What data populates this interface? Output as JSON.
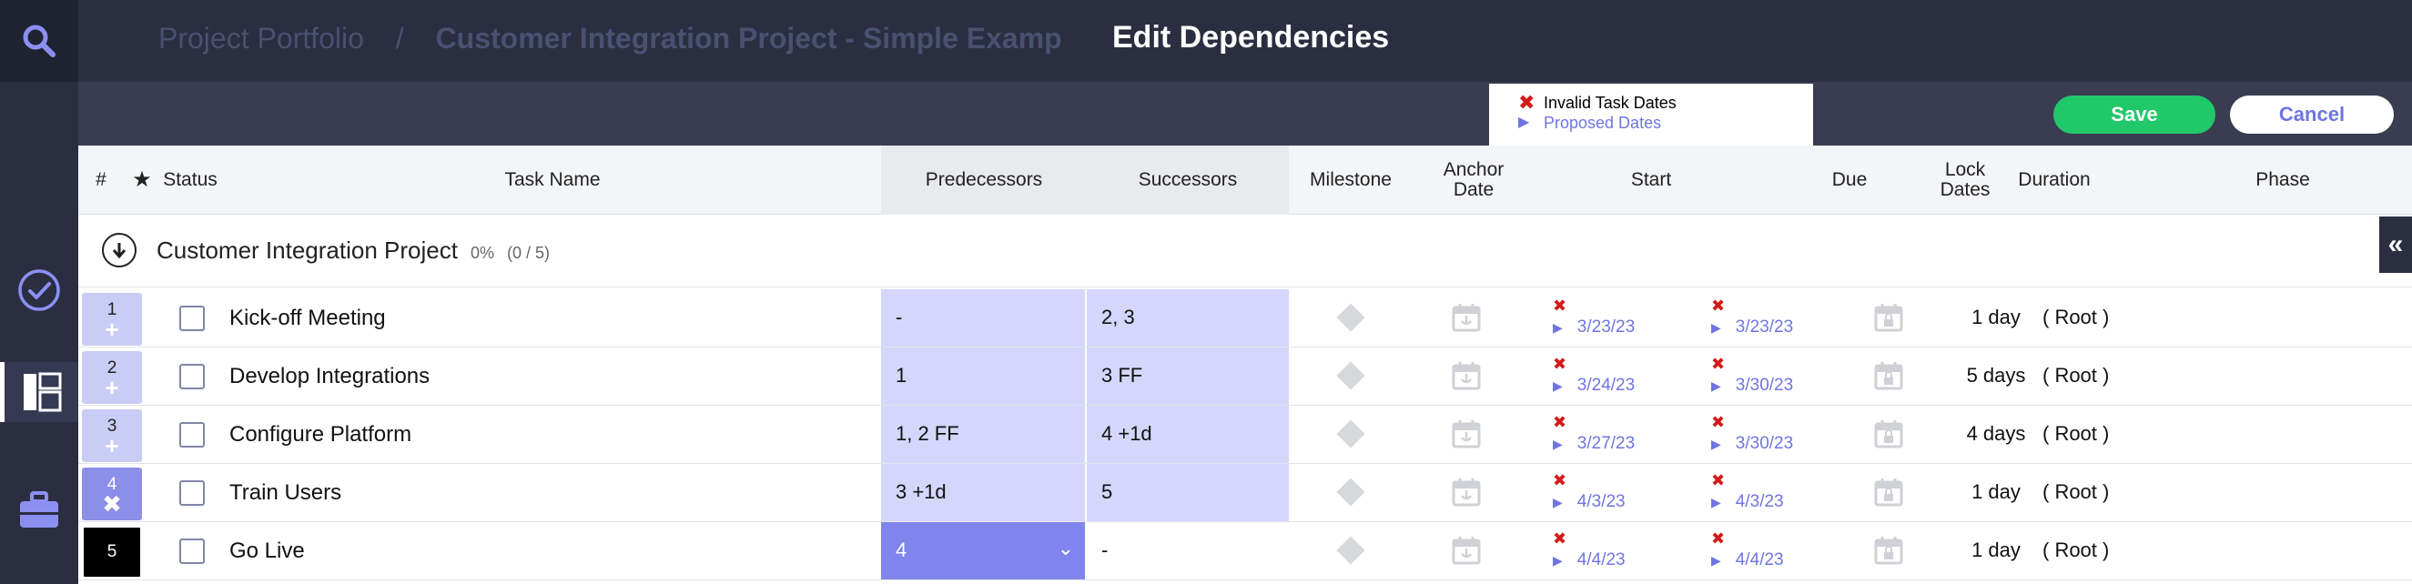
{
  "breadcrumb": {
    "portfolio": "Project Portfolio",
    "separator": "/",
    "project": "Customer Integration Project  -  Simple Examp"
  },
  "modal": {
    "title": "Edit Dependencies",
    "save_label": "Save",
    "cancel_label": "Cancel"
  },
  "legend": {
    "invalid": "Invalid Task Dates",
    "proposed": "Proposed Dates"
  },
  "columns": {
    "num": "#",
    "star": "★",
    "status": "Status",
    "task_name": "Task Name",
    "predecessors": "Predecessors",
    "successors": "Successors",
    "milestone": "Milestone",
    "anchor_line1": "Anchor",
    "anchor_line2": "Date",
    "start": "Start",
    "due": "Due",
    "lock_line1": "Lock",
    "lock_line2": "Dates",
    "duration": "Duration",
    "phase": "Phase"
  },
  "group": {
    "name": "Customer Integration Project",
    "percent": "0%",
    "count": "(0 / 5)",
    "collapse_glyph": "«"
  },
  "rows": [
    {
      "num": "1",
      "icon": "+",
      "task": "Kick-off Meeting",
      "pred": "-",
      "succ": "2, 3",
      "start": "3/23/23",
      "due": "3/23/23",
      "duration": "1 day",
      "phase": "( Root )"
    },
    {
      "num": "2",
      "icon": "+",
      "task": "Develop Integrations",
      "pred": "1",
      "succ": "3 FF",
      "start": "3/24/23",
      "due": "3/30/23",
      "duration": "5 days",
      "phase": "( Root )"
    },
    {
      "num": "3",
      "icon": "+",
      "task": "Configure Platform",
      "pred": "1, 2 FF",
      "succ": "4 +1d",
      "start": "3/27/23",
      "due": "3/30/23",
      "duration": "4 days",
      "phase": "( Root )"
    },
    {
      "num": "4",
      "icon": "✖",
      "task": "Train Users",
      "pred": "3 +1d",
      "succ": "5",
      "start": "4/3/23",
      "due": "4/3/23",
      "duration": "1 day",
      "phase": "( Root )"
    },
    {
      "num": "5",
      "icon": "",
      "task": "Go Live",
      "pred": "4",
      "succ": "-",
      "start": "4/4/23",
      "due": "4/4/23",
      "duration": "1 day",
      "phase": "( Root )"
    }
  ],
  "colors": {
    "accent": "#6f75e0",
    "save": "#21c86a",
    "invalid": "#d11a1a",
    "dependency_cell": "#d4d6fb",
    "dependency_active": "#7f85ec"
  }
}
